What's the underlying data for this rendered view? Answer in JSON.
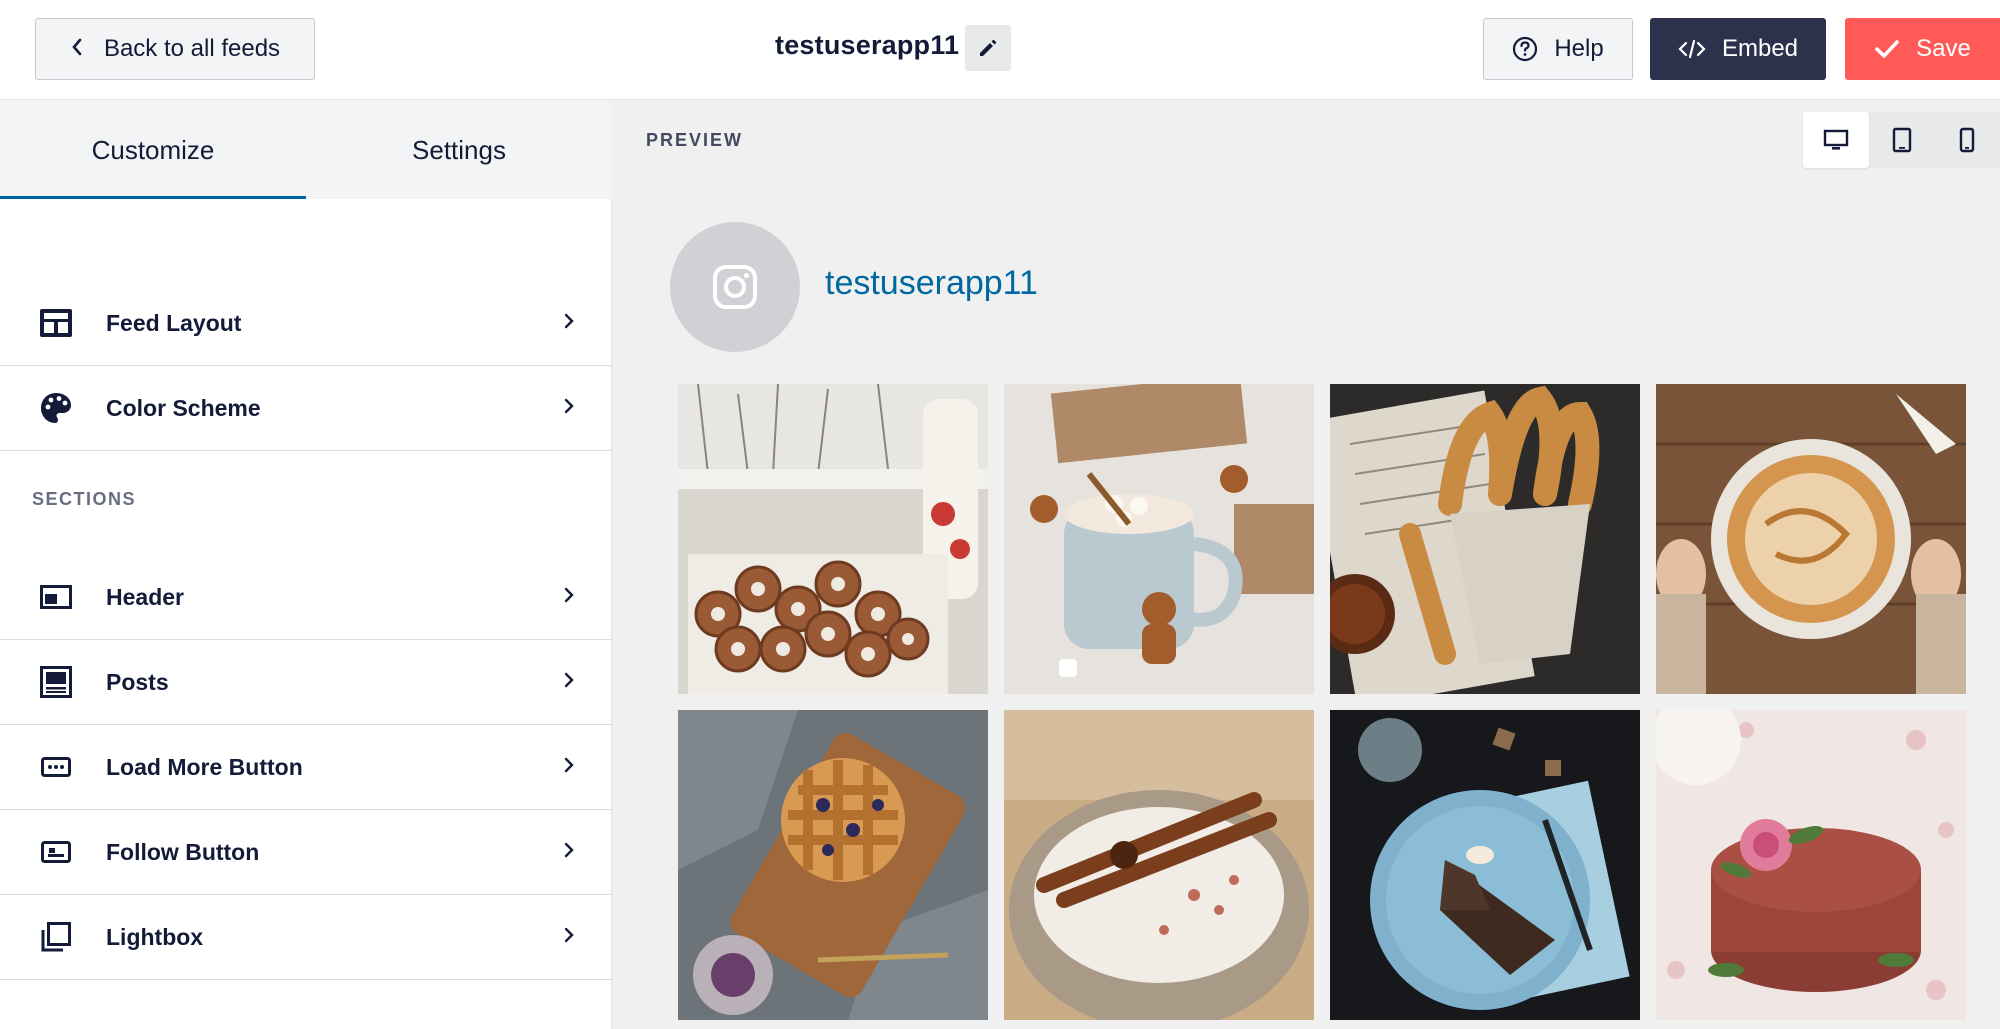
{
  "header": {
    "back_label": "Back to all feeds",
    "feed_name": "testuserapp11",
    "help_label": "Help",
    "embed_label": "Embed",
    "save_label": "Save"
  },
  "sidebar": {
    "tabs": [
      {
        "label": "Customize",
        "active": true
      },
      {
        "label": "Settings",
        "active": false
      }
    ],
    "items": [
      {
        "label": "Feed Layout",
        "icon": "layout-grid-icon"
      },
      {
        "label": "Color Scheme",
        "icon": "palette-icon"
      }
    ],
    "sections_label": "SECTIONS",
    "sections": [
      {
        "label": "Header",
        "icon": "header-icon"
      },
      {
        "label": "Posts",
        "icon": "posts-icon"
      },
      {
        "label": "Load More Button",
        "icon": "load-more-icon"
      },
      {
        "label": "Follow Button",
        "icon": "follow-icon"
      },
      {
        "label": "Lightbox",
        "icon": "lightbox-icon"
      }
    ]
  },
  "preview": {
    "label": "PREVIEW",
    "devices": [
      {
        "name": "desktop",
        "active": true
      },
      {
        "name": "tablet",
        "active": false
      },
      {
        "name": "mobile",
        "active": false
      }
    ],
    "profile_name": "testuserapp11",
    "photos": [
      {
        "subject": "donuts and milk bottle by window"
      },
      {
        "subject": "hot chocolate with gingerbread"
      },
      {
        "subject": "churros on newspaper"
      },
      {
        "subject": "caramel pie on wooden table"
      },
      {
        "subject": "lattice berry pie"
      },
      {
        "subject": "cinnamon latte"
      },
      {
        "subject": "chocolate cake slice on blue plate"
      },
      {
        "subject": "chocolate cake with rose"
      }
    ]
  },
  "colors": {
    "accent": "#0068a0",
    "embed_bg": "#2c324c",
    "save_bg": "#ff5a57",
    "text": "#141b38"
  }
}
